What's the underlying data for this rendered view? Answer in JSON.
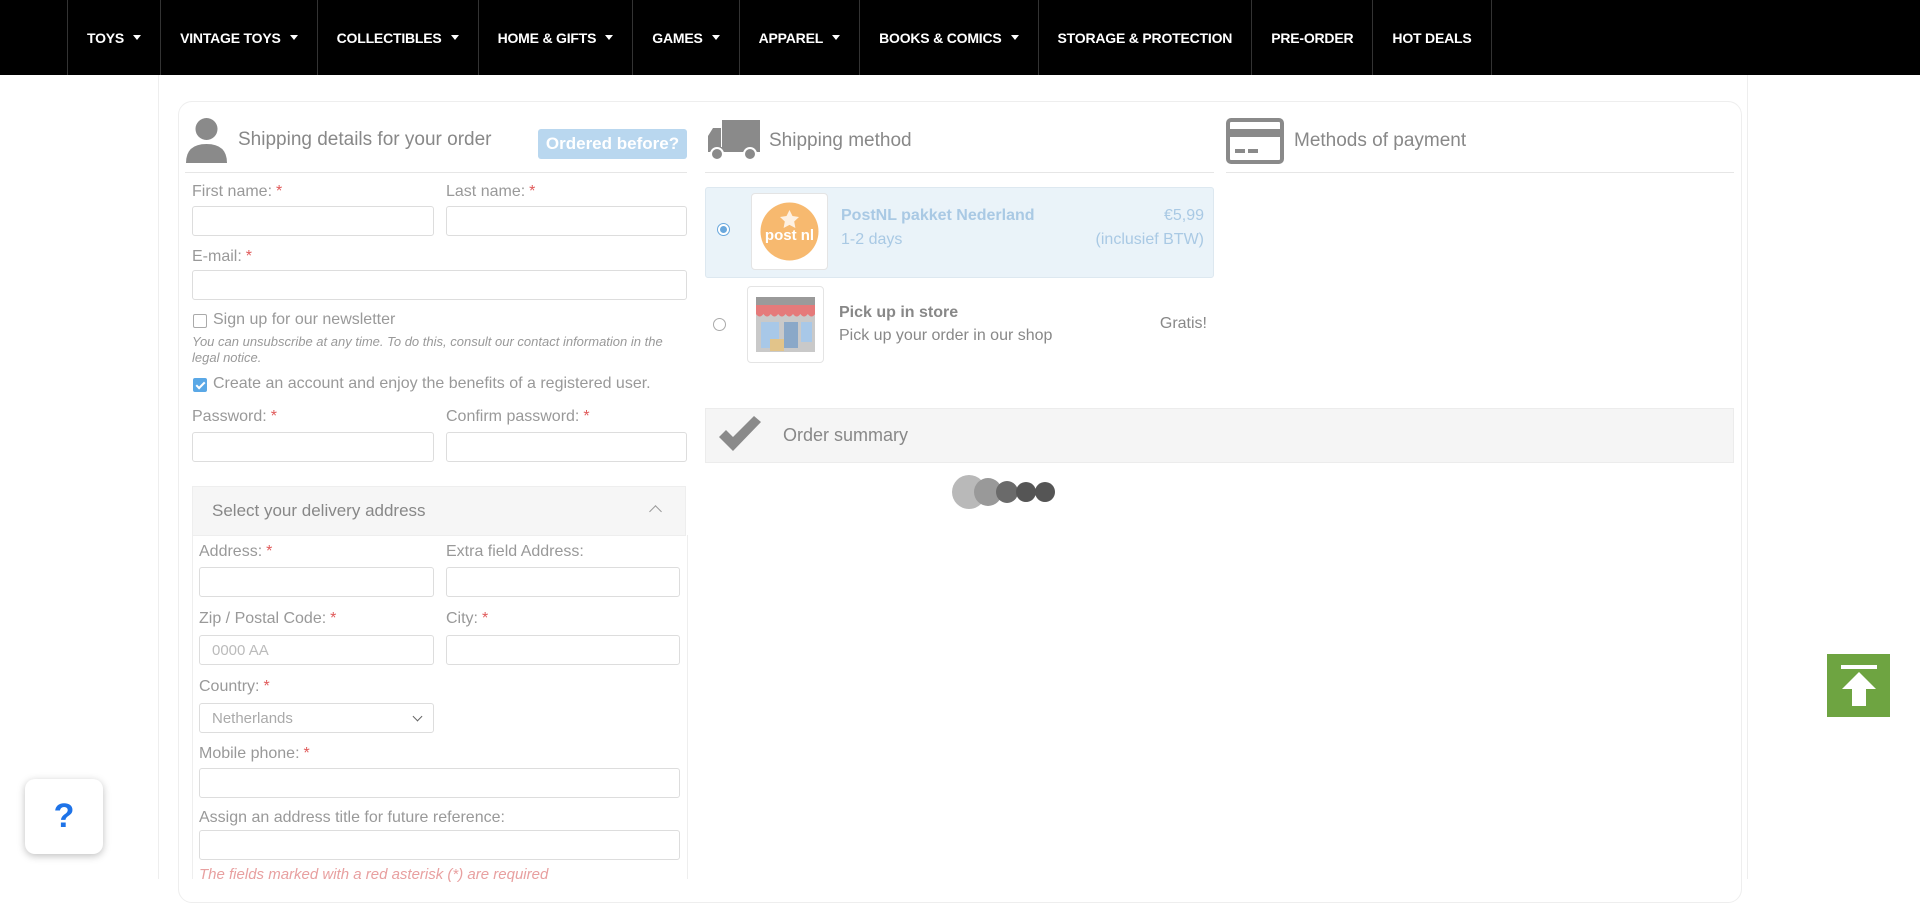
{
  "nav": {
    "items": [
      {
        "label": "TOYS",
        "dropdown": true
      },
      {
        "label": "VINTAGE TOYS",
        "dropdown": true
      },
      {
        "label": "COLLECTIBLES",
        "dropdown": true
      },
      {
        "label": "HOME & GIFTS",
        "dropdown": true
      },
      {
        "label": "GAMES",
        "dropdown": true
      },
      {
        "label": "APPAREL",
        "dropdown": true
      },
      {
        "label": "BOOKS & COMICS",
        "dropdown": true
      },
      {
        "label": "STORAGE & PROTECTION",
        "dropdown": false
      },
      {
        "label": "PRE-ORDER",
        "dropdown": false
      },
      {
        "label": "HOT DEALS",
        "dropdown": false
      }
    ]
  },
  "shipping_details": {
    "title": "Shipping details for your order",
    "ordered_before": "Ordered before?",
    "first_name_label": "First name:",
    "last_name_label": "Last name:",
    "email_label": "E-mail:",
    "newsletter_label": "Sign up for our newsletter",
    "newsletter_note": "You can unsubscribe at any time. To do this, consult our contact information in the legal notice.",
    "create_account_label": "Create an account and enjoy the benefits of a registered user.",
    "create_account_checked": true,
    "password_label": "Password:",
    "confirm_password_label": "Confirm password:",
    "required_mark": "*"
  },
  "delivery": {
    "title": "Select your delivery address",
    "address_label": "Address:",
    "extra_address_label": "Extra field Address:",
    "zip_label": "Zip / Postal Code:",
    "zip_placeholder": "0000 AA",
    "city_label": "City:",
    "country_label": "Country:",
    "country_value": "Netherlands",
    "mobile_label": "Mobile phone:",
    "address_title_label": "Assign an address title for future reference:",
    "required_note": "The fields marked with a red asterisk (*) are required"
  },
  "shipping_method": {
    "title": "Shipping method",
    "options": [
      {
        "name": "PostNL pakket Nederland",
        "desc": "1-2 days",
        "price": "€5,99",
        "price_note": "(inclusief BTW)",
        "selected": true,
        "logo_text": "post nl"
      },
      {
        "name": "Pick up in store",
        "desc": "Pick up your order in our shop",
        "price": "Gratis!",
        "selected": false
      }
    ]
  },
  "payment": {
    "title": "Methods of payment"
  },
  "order_summary": {
    "title": "Order summary"
  },
  "help": {
    "label": "?"
  },
  "colors": {
    "accent": "#6aa8dd",
    "nav_bg": "#000000",
    "back_to_top": "#6ea441",
    "help_icon": "#1e73e8",
    "required": "#e05a5a"
  }
}
